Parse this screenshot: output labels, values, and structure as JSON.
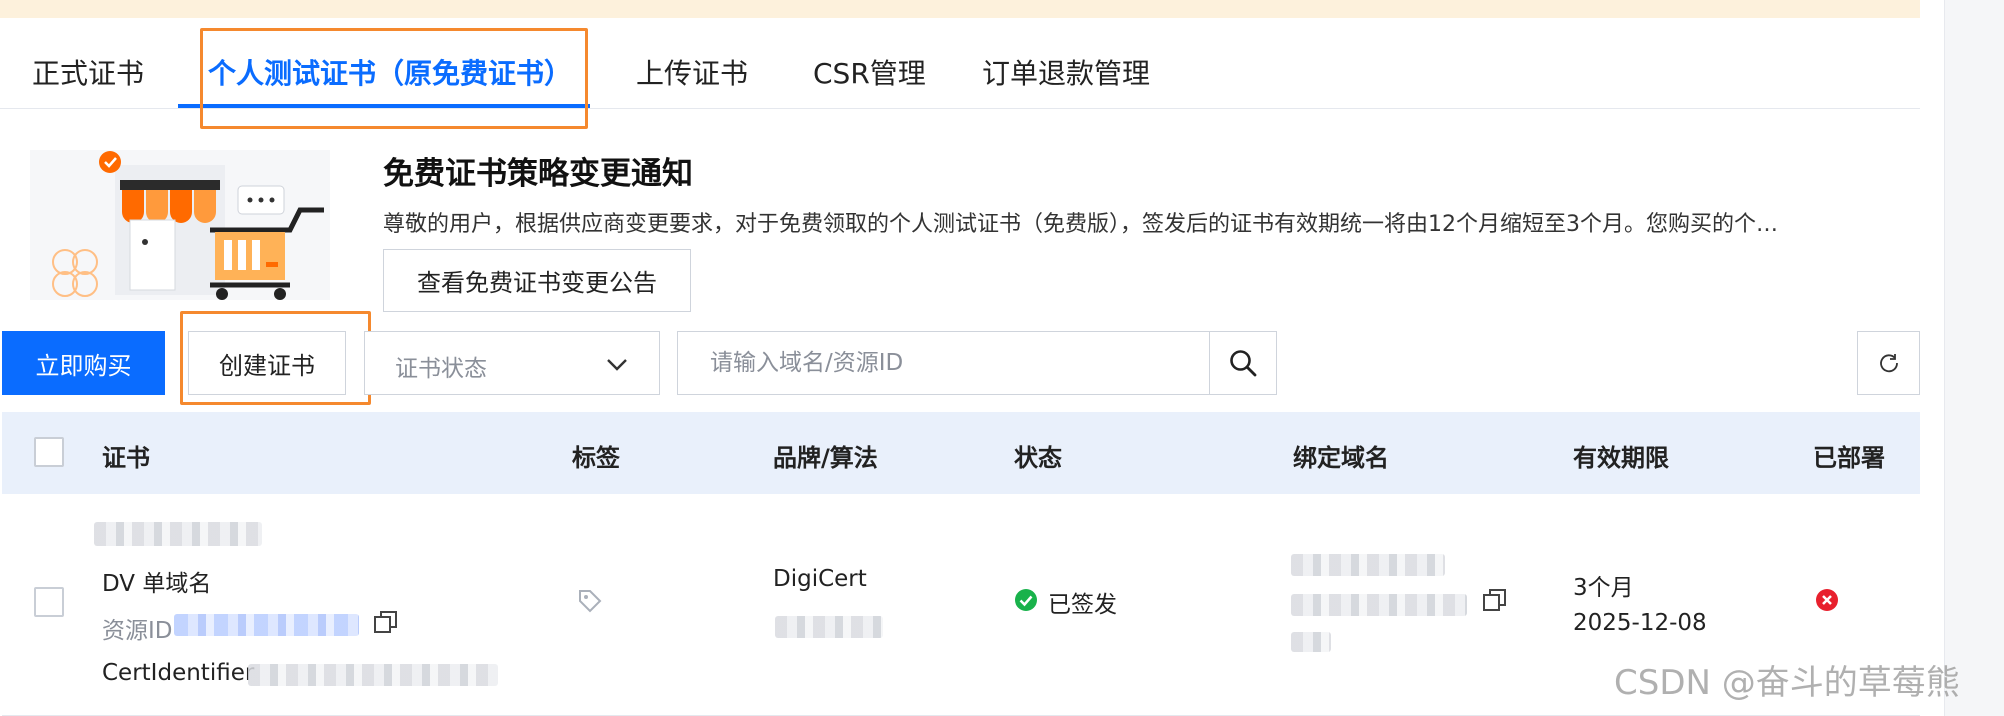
{
  "tabs": [
    {
      "label": "正式证书"
    },
    {
      "label": "个人测试证书（原免费证书）",
      "active": true
    },
    {
      "label": "上传证书"
    },
    {
      "label": "CSR管理"
    },
    {
      "label": "订单退款管理"
    }
  ],
  "notice": {
    "title": "免费证书策略变更通知",
    "text": "尊敬的用户，根据供应商变更要求，对于免费领取的个人测试证书（免费版），签发后的证书有效期统一将由12个月缩短至3个月。您购买的个…",
    "button_label": "查看免费证书变更公告"
  },
  "toolbar": {
    "buy_label": "立即购买",
    "create_label": "创建证书",
    "status_placeholder": "证书状态",
    "search_placeholder": "请输入域名/资源ID"
  },
  "table": {
    "columns": [
      "证书",
      "标签",
      "品牌/算法",
      "状态",
      "绑定域名",
      "有效期限",
      "已部署"
    ],
    "rows": [
      {
        "type": "DV 单域名",
        "resource_id_label": "资源ID",
        "cert_identifier_label": "CertIdentifier",
        "brand": "DigiCert",
        "status": "已签发",
        "validity": "3个月",
        "expiry": "2025-12-08"
      }
    ]
  },
  "colors": {
    "primary": "#0a6cff",
    "highlight": "#f5892e",
    "success": "#19b24b",
    "danger": "#e8202d",
    "header_bg": "#e9f0fb"
  },
  "watermark": "CSDN @奋斗的草莓熊"
}
